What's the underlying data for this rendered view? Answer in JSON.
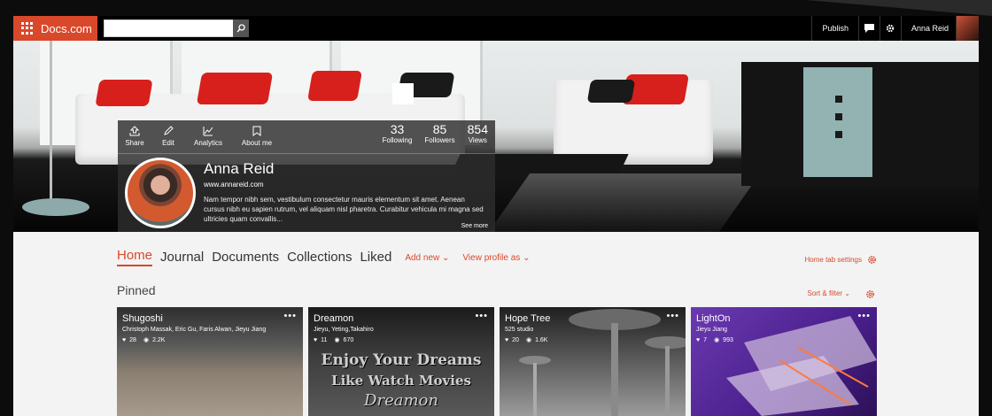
{
  "app": {
    "brand": "Docs.com"
  },
  "search": {
    "placeholder": ""
  },
  "topbar": {
    "publish": "Publish",
    "user_name": "Anna Reid"
  },
  "profile": {
    "actions": [
      "Share",
      "Edit",
      "Analytics",
      "About me"
    ],
    "stats": [
      {
        "num": "33",
        "label": "Following"
      },
      {
        "num": "85",
        "label": "Followers"
      },
      {
        "num": "854",
        "label": "Views"
      }
    ],
    "name": "Anna Reid",
    "url": "www.annareid.com",
    "bio": "Nam tempor nibh sem, vestibulum consectetur mauris elementum sit amet. Aenean cursus nibh eu sapien rutrum, vel aliquam nisl pharetra. Curabitur vehicula mi magna sed ultricies quam convallis...",
    "see_more": "See more"
  },
  "tabs": [
    "Home",
    "Journal",
    "Documents",
    "Collections",
    "Liked"
  ],
  "tab_links": {
    "add_new": "Add new",
    "view_profile": "View profile as"
  },
  "home_settings": "Home tab settings",
  "pinned": {
    "title": "Pinned",
    "sort": "Sort & filter"
  },
  "cards": [
    {
      "title": "Shugoshi",
      "authors": "Christoph Massak, Eric Gu, Faris Alwan, Jieyu Jiang",
      "likes": "28",
      "views": "2.2K"
    },
    {
      "title": "Dreamon",
      "authors": "Jieyu, Yeting,Takahiro",
      "likes": "11",
      "views": "670",
      "art": [
        "Enjoy Your Dreams",
        "Like Watch Movies",
        "Dreamon"
      ]
    },
    {
      "title": "Hope Tree",
      "authors": "525 studio",
      "likes": "20",
      "views": "1.6K"
    },
    {
      "title": "LightOn",
      "authors": "Jieyu Jiang",
      "likes": "7",
      "views": "993"
    }
  ],
  "colors": {
    "accent": "#d9482b",
    "background": "#f3f3f3"
  }
}
